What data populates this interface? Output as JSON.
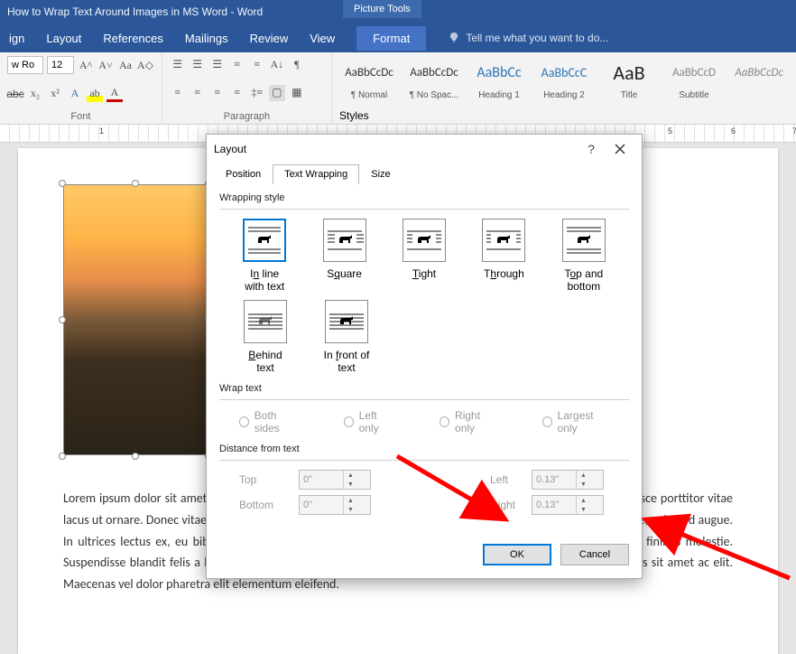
{
  "titlebar": {
    "title": "How to Wrap Text Around Images in MS Word - Word",
    "context_tab": "Picture Tools"
  },
  "tabs": {
    "design": "ign",
    "layout": "Layout",
    "references": "References",
    "mailings": "Mailings",
    "review": "Review",
    "view": "View",
    "format": "Format",
    "tellme": "Tell me what you want to do..."
  },
  "ribbon": {
    "font_name": "w Ro",
    "font_size": "12",
    "font_label": "Font",
    "paragraph_label": "Paragraph",
    "styles_label": "Styles",
    "styles": {
      "normal": {
        "prev": "AaBbCcDc",
        "name": "¶ Normal"
      },
      "nospac": {
        "prev": "AaBbCcDc",
        "name": "¶ No Spac..."
      },
      "h1": {
        "prev": "AaBbCc",
        "name": "Heading 1"
      },
      "h2": {
        "prev": "AaBbCcC",
        "name": "Heading 2"
      },
      "title": {
        "prev": "AaB",
        "name": "Title"
      },
      "subtitle": {
        "prev": "AaBbCcD",
        "name": "Subtitle"
      },
      "subtletext": {
        "prev": "AaBbCcDc",
        "name": ""
      }
    }
  },
  "ruler": {
    "m1": "1",
    "m5": "5",
    "m6": "6",
    "m7": "7"
  },
  "doc": {
    "body": "Lorem ipsum dolor sit amet, consectetur adipiscing elit. Nam elementum pretium metus, id bibendum odio. Fusce porttitor vitae lacus ut ornare. Donec vitae gravida sem. Ut egestas metus sit amet enim. Morbi ut odio finibus, volutpat ex vitae, euismod augue. In ultrices lectus ex, eu bibendum neque cursus eu. Nunc sed auctor turpis. Integer sit amet urna non arcu finibus molestie. Suspendisse blandit felis a leo pellentesque, non rhoncus sapien porta. In at justo sit amet mauris iaculis mollis sit amet ac elit. Maecenas vel dolor pharetra elit elementum eleifend."
  },
  "dialog": {
    "title": "Layout",
    "tabs": {
      "position": "Position",
      "wrapping": "Text Wrapping",
      "size": "Size"
    },
    "wrapping_style_label": "Wrapping style",
    "items": {
      "inline": {
        "pre": "I",
        "u": "n",
        "post": " line with text"
      },
      "square": {
        "pre": "S",
        "u": "q",
        "post": "uare"
      },
      "tight": {
        "pre": "",
        "u": "T",
        "post": "ight"
      },
      "through": {
        "pre": "T",
        "u": "h",
        "post": "rough"
      },
      "topbot": {
        "pre": "T",
        "u": "o",
        "post": "p and bottom"
      },
      "behind": {
        "pre": "",
        "u": "B",
        "post": "ehind text"
      },
      "front": {
        "pre": "In ",
        "u": "f",
        "post": "ront of text"
      }
    },
    "wrap_text_label": "Wrap text",
    "radios": {
      "both": "Both sides",
      "left": "Left only",
      "right": "Right only",
      "largest": "Largest only"
    },
    "distance_label": "Distance from text",
    "dist": {
      "top_label": "Top",
      "top": "0\"",
      "bottom_label": "Bottom",
      "bottom": "0\"",
      "left_label": "Left",
      "left": "0.13\"",
      "right_label": "Right",
      "right": "0.13\""
    },
    "buttons": {
      "ok": "OK",
      "cancel": "Cancel"
    }
  }
}
